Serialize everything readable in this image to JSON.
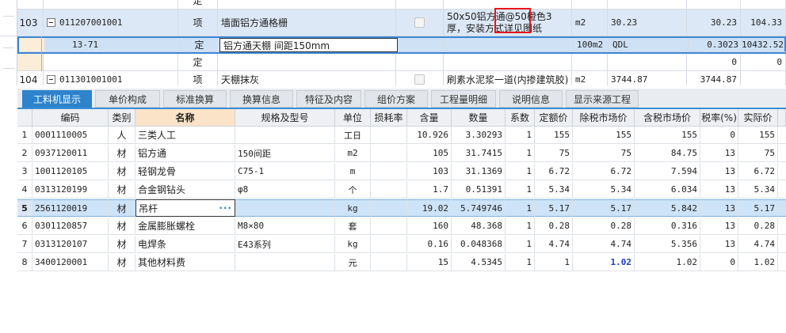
{
  "upper_rows": [
    {
      "num": "",
      "code": "",
      "type": "定",
      "name": "",
      "spec": "",
      "unit": "",
      "expr": "",
      "qty": "",
      "amount": ""
    },
    {
      "num": "103",
      "code": "011207001001",
      "type": "项",
      "name": "墙面铝方通格栅",
      "spec": "50x50铝方通@50橙色3厚，安装方式详见图纸",
      "unit": "m2",
      "expr": "30.23",
      "qty": "30.23",
      "amount": "104.33"
    },
    {
      "num": "",
      "code": "13-71",
      "type": "定",
      "name": "铝方通天棚 间距150mm",
      "spec": "",
      "unit": "100m2",
      "expr": "QDL",
      "qty": "0.3023",
      "amount": "10432.52"
    },
    {
      "num": "",
      "code": "",
      "type": "定",
      "name": "",
      "spec": "",
      "unit": "",
      "expr": "",
      "qty": "0",
      "amount": "0"
    },
    {
      "num": "104",
      "code": "011301001001",
      "type": "项",
      "name": "天棚抹灰",
      "spec": "刷素水泥浆一道(内掺建筑胶)",
      "unit": "m2",
      "expr": "3744.87",
      "qty": "3744.87",
      "amount": ""
    }
  ],
  "tabs": [
    "工料机显示",
    "单价构成",
    "标准换算",
    "换算信息",
    "特征及内容",
    "组价方案",
    "工程量明细",
    "说明信息",
    "显示来源工程"
  ],
  "columns": [
    "编码",
    "类别",
    "名称",
    "规格及型号",
    "单位",
    "损耗率",
    "含量",
    "数量",
    "系数",
    "定额价",
    "除税市场价",
    "含税市场价",
    "税率(%)",
    "实际价"
  ],
  "rows": [
    {
      "num": "1",
      "code": "0001110005",
      "cat": "人",
      "name": "三类人工",
      "spec": "",
      "unit": "工日",
      "loss": "",
      "content": "10.926",
      "qty": "3.30293",
      "coef": "1",
      "quota": "155",
      "ex_tax": "155",
      "inc_tax": "155",
      "tax": "0",
      "actual": "155"
    },
    {
      "num": "2",
      "code": "0937120011",
      "cat": "材",
      "name": "铝方通",
      "spec": "150间距",
      "unit": "m2",
      "loss": "",
      "content": "105",
      "qty": "31.7415",
      "coef": "1",
      "quota": "75",
      "ex_tax": "75",
      "inc_tax": "84.75",
      "tax": "13",
      "actual": "75"
    },
    {
      "num": "3",
      "code": "1001120105",
      "cat": "材",
      "name": "轻钢龙骨",
      "spec": "C75-1",
      "unit": "m",
      "loss": "",
      "content": "103",
      "qty": "31.1369",
      "coef": "1",
      "quota": "6.72",
      "ex_tax": "6.72",
      "inc_tax": "7.594",
      "tax": "13",
      "actual": "6.72"
    },
    {
      "num": "4",
      "code": "0313120199",
      "cat": "材",
      "name": "合金钢钻头",
      "spec": "φ8",
      "unit": "个",
      "loss": "",
      "content": "1.7",
      "qty": "0.51391",
      "coef": "1",
      "quota": "5.34",
      "ex_tax": "5.34",
      "inc_tax": "6.034",
      "tax": "13",
      "actual": "5.34"
    },
    {
      "num": "5",
      "code": "2561120019",
      "cat": "材",
      "name": "吊杆",
      "spec": "",
      "unit": "kg",
      "loss": "",
      "content": "19.02",
      "qty": "5.749746",
      "coef": "1",
      "quota": "5.17",
      "ex_tax": "5.17",
      "inc_tax": "5.842",
      "tax": "13",
      "actual": "5.17"
    },
    {
      "num": "6",
      "code": "0301120857",
      "cat": "材",
      "name": "金属膨胀螺栓",
      "spec": "M8×80",
      "unit": "套",
      "loss": "",
      "content": "160",
      "qty": "48.368",
      "coef": "1",
      "quota": "0.28",
      "ex_tax": "0.28",
      "inc_tax": "0.316",
      "tax": "13",
      "actual": "0.28"
    },
    {
      "num": "7",
      "code": "0313120107",
      "cat": "材",
      "name": "电焊条",
      "spec": "E43系列",
      "unit": "kg",
      "loss": "",
      "content": "0.16",
      "qty": "0.048368",
      "coef": "1",
      "quota": "4.74",
      "ex_tax": "4.74",
      "inc_tax": "5.356",
      "tax": "13",
      "actual": "4.74"
    },
    {
      "num": "8",
      "code": "3400120001",
      "cat": "材",
      "name": "其他材料费",
      "spec": "",
      "unit": "元",
      "loss": "",
      "content": "15",
      "qty": "4.5345",
      "coef": "1",
      "quota": "1",
      "ex_tax": "1.02",
      "inc_tax": "1.02",
      "tax": "0",
      "actual": "1.02"
    }
  ],
  "ellipsis": "···",
  "colors": {
    "tab_active": "#2d83cc",
    "selected_row": "#cde3f7",
    "highlight_header": "#fbe3c7",
    "annotation_box": "#e6161b"
  }
}
